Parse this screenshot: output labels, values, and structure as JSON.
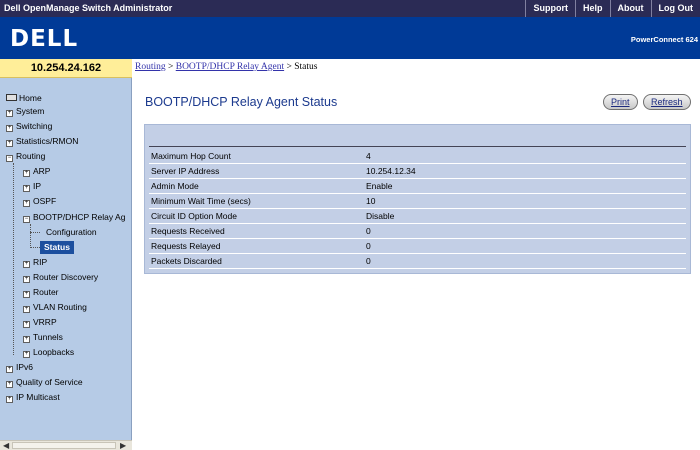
{
  "titlebar": {
    "app_title": "Dell OpenManage Switch Administrator",
    "links": [
      "Support",
      "Help",
      "About",
      "Log Out"
    ]
  },
  "banner": {
    "logo": "DELL",
    "model": "PowerConnect 624"
  },
  "ip_address": "10.254.24.162",
  "breadcrumb": {
    "part1": "Routing",
    "sep1": " > ",
    "part2": "BOOTP/DHCP Relay Agent",
    "sep2": " > ",
    "current": "Status"
  },
  "sidebar": {
    "home": "Home",
    "system": "System",
    "switching": "Switching",
    "statistics": "Statistics/RMON",
    "routing": "Routing",
    "arp": "ARP",
    "ip": "IP",
    "ospf": "OSPF",
    "bootp": "BOOTP/DHCP Relay Ag",
    "configuration": "Configuration",
    "status": "Status",
    "rip": "RIP",
    "router_discovery": "Router Discovery",
    "router": "Router",
    "vlan_routing": "VLAN Routing",
    "vrrp": "VRRP",
    "tunnels": "Tunnels",
    "loopbacks": "Loopbacks",
    "ipv6": "IPv6",
    "qos": "Quality of Service",
    "ip_multicast": "IP Multicast"
  },
  "page": {
    "title": "BOOTP/DHCP Relay Agent Status",
    "print_label": "Print",
    "refresh_label": "Refresh"
  },
  "table": {
    "rows": [
      {
        "label": "Maximum Hop Count",
        "value": "4"
      },
      {
        "label": "Server IP Address",
        "value": "10.254.12.34"
      },
      {
        "label": "Admin Mode",
        "value": "Enable"
      },
      {
        "label": "Minimum Wait Time (secs)",
        "value": "10"
      },
      {
        "label": "Circuit ID Option Mode",
        "value": "Disable"
      },
      {
        "label": "Requests Received",
        "value": "0"
      },
      {
        "label": "Requests Relayed",
        "value": "0"
      },
      {
        "label": "Packets Discarded",
        "value": "0"
      }
    ]
  },
  "colors": {
    "titlebar": "#2b2b55",
    "banner": "#003a97",
    "sidebar": "#b6cbe6",
    "panel": "#c3cfe6",
    "ip_cell": "#ffee99",
    "active_item": "#1c4f9e"
  }
}
